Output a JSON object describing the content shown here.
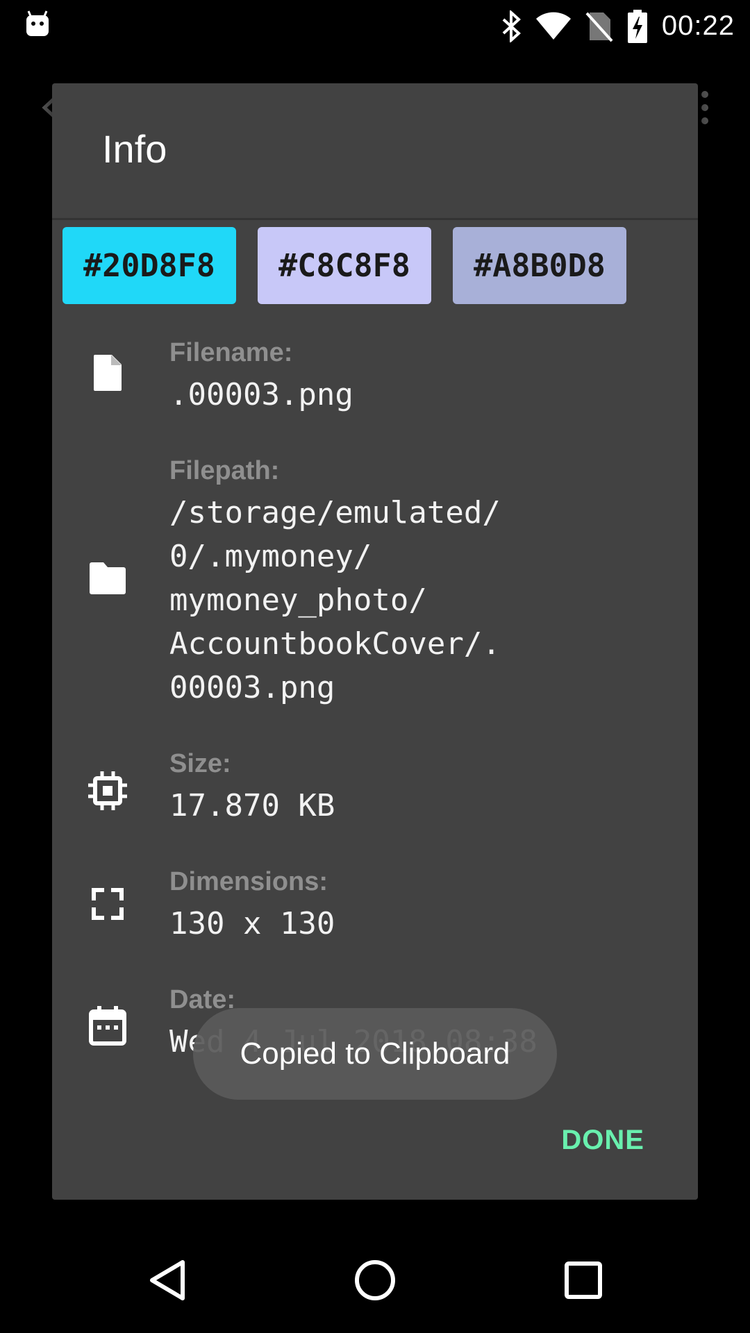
{
  "status_bar": {
    "time": "00:22",
    "icons": [
      "android-notification-icon",
      "bluetooth-icon",
      "wifi-icon",
      "no-sim-icon",
      "battery-charging-icon"
    ]
  },
  "dialog": {
    "title": "Info",
    "swatches": [
      {
        "label": "#20D8F8",
        "color": "#20D8F8"
      },
      {
        "label": "#C8C8F8",
        "color": "#C8C8F8"
      },
      {
        "label": "#A8B0D8",
        "color": "#A8B0D8"
      }
    ],
    "rows": [
      {
        "icon": "file-icon",
        "label": "Filename:",
        "value": ".00003.png"
      },
      {
        "icon": "folder-icon",
        "label": "Filepath:",
        "value": "/storage/emulated/\n0/.mymoney/\nmymoney_photo/\nAccountbookCover/.\n00003.png"
      },
      {
        "icon": "memory-chip-icon",
        "label": "Size:",
        "value": "17.870 KB"
      },
      {
        "icon": "fullscreen-icon",
        "label": "Dimensions:",
        "value": "130 x 130"
      },
      {
        "icon": "calendar-icon",
        "label": "Date:",
        "value": "Wed 4 Jul 2018 08:38"
      }
    ],
    "done_label": "DONE"
  },
  "toast": {
    "message": "Copied to Clipboard"
  },
  "nav_bar": {
    "buttons": [
      "back-icon",
      "home-icon",
      "recents-icon"
    ]
  },
  "colors": {
    "dialog_bg": "#424242",
    "accent": "#69F0AE",
    "label": "#8F8F8F"
  }
}
